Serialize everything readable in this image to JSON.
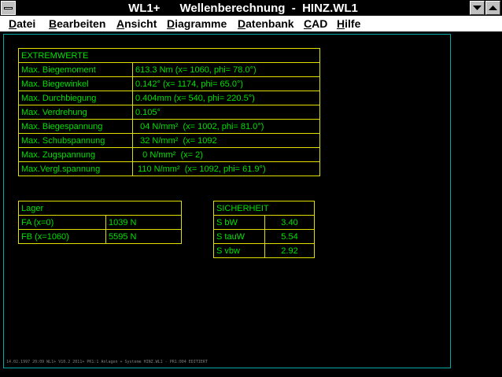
{
  "window": {
    "title": "WL1+      Wellenberechnung  -  HINZ.WL1"
  },
  "menu": [
    {
      "first": "D",
      "rest": "atei"
    },
    {
      "first": "B",
      "rest": "earbeiten"
    },
    {
      "first": "A",
      "rest": "nsicht"
    },
    {
      "first": "D",
      "rest": "iagramme"
    },
    {
      "first": "D",
      "rest": "atenbank"
    },
    {
      "first": "C",
      "rest": "AD"
    },
    {
      "first": "H",
      "rest": "ilfe"
    }
  ],
  "extremwerte": {
    "header": "EXTREMWERTE",
    "rows": [
      {
        "label": "Max. Biegemoment",
        "value": "613.3 Nm  (x= 1060, phi= 78.0°)"
      },
      {
        "label": "Max. Biegewinkel",
        "value": "0.142°  (x= 1174, phi= 65.0°)"
      },
      {
        "label": "Max. Durchbiegung",
        "value": "0.404mm  (x= 540, phi= 220.5°)"
      },
      {
        "label": "Max. Verdrehung",
        "value": "0.105°"
      },
      {
        "label": "Max. Biegespannung",
        "value": "  04 N/mm²  (x= 1002, phi= 81.0°)"
      },
      {
        "label": "Max. Schubspannung",
        "value": "  32 N/mm²  (x= 1092"
      },
      {
        "label": "Max. Zugspannung",
        "value": "   0 N/mm²  (x= 2)"
      },
      {
        "label": "Max.Vergl.spannung",
        "value": " 110 N/mm²  (x= 1092, phi= 61.9°)"
      }
    ]
  },
  "lager": {
    "header": "Lager",
    "rows": [
      {
        "label": "FA (x=0)",
        "value": "1039 N"
      },
      {
        "label": "FB (x=1060)",
        "value": "5595 N"
      }
    ]
  },
  "sicherheit": {
    "header": "SICHERHEIT",
    "rows": [
      {
        "label": "S bW",
        "value": "3.40"
      },
      {
        "label": "S tauW",
        "value": "5.54"
      },
      {
        "label": "S vbw",
        "value": "2.92"
      }
    ]
  },
  "footer": {
    "text": "14.02.1997 20:09   WL1+ V10.2 2011+    PK1:1 Anlagen + Systeme    HINZ.WL1 - PR1:004 EDITIERT"
  },
  "colors": {
    "text": "#00e000",
    "grid": "#e0e000",
    "frame": "#00a8a8",
    "background": "#000000"
  }
}
